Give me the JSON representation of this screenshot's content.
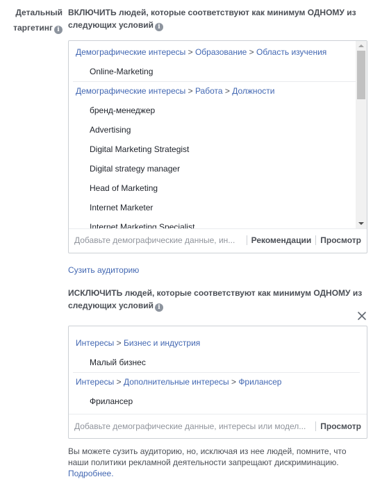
{
  "sidebar": {
    "label_line1": "Детальный",
    "label_line2": "таргетинг",
    "info_icon": "info-icon"
  },
  "include": {
    "heading_line1": "ВКЛЮЧИТЬ людей, которые соответствуют как минимум ОДНОМУ из",
    "heading_line2": "следующих условий",
    "groups": [
      {
        "path": [
          "Демографические интересы",
          "Образование",
          "Область изучения"
        ],
        "items": [
          "Online-Marketing"
        ]
      },
      {
        "path": [
          "Демографические интересы",
          "Работа",
          "Должности"
        ],
        "items": [
          "бренд-менеджер",
          "Advertising",
          "Digital Marketing Strategist",
          "Digital strategy manager",
          "Head of Marketing",
          "Internet Marketer",
          "Internet Marketing Specialist"
        ]
      }
    ],
    "input_placeholder": "Добавьте демографические данные, ин...",
    "recommendations_label": "Рекомендации",
    "browse_label": "Просмотр"
  },
  "narrow_link": "Сузить аудиторию",
  "exclude": {
    "heading_line1": "ИСКЛЮЧИТЬ людей, которые соответствуют как минимум ОДНОМУ из",
    "heading_line2": "следующих условий",
    "groups": [
      {
        "path": [
          "Интересы",
          "Бизнес и индустрия"
        ],
        "items": [
          "Малый бизнес"
        ]
      },
      {
        "path": [
          "Интересы",
          "Дополнительные интересы",
          "Фрилансер"
        ],
        "items": [
          "Фрилансер"
        ]
      }
    ],
    "input_placeholder": "Добавьте демографические данные, интересы или модел...",
    "browse_label": "Просмотр"
  },
  "footer": {
    "note_line1": "Вы можете сузить аудиторию, но, исключая из нее людей, помните, что",
    "note_line2": "наши политики рекламной деятельности запрещают дискриминацию.",
    "more_link": "Подробнее."
  },
  "path_separator": ">",
  "colors": {
    "link": "#4267b2",
    "text": "#4b4f56",
    "border": "#ccd0d5"
  }
}
